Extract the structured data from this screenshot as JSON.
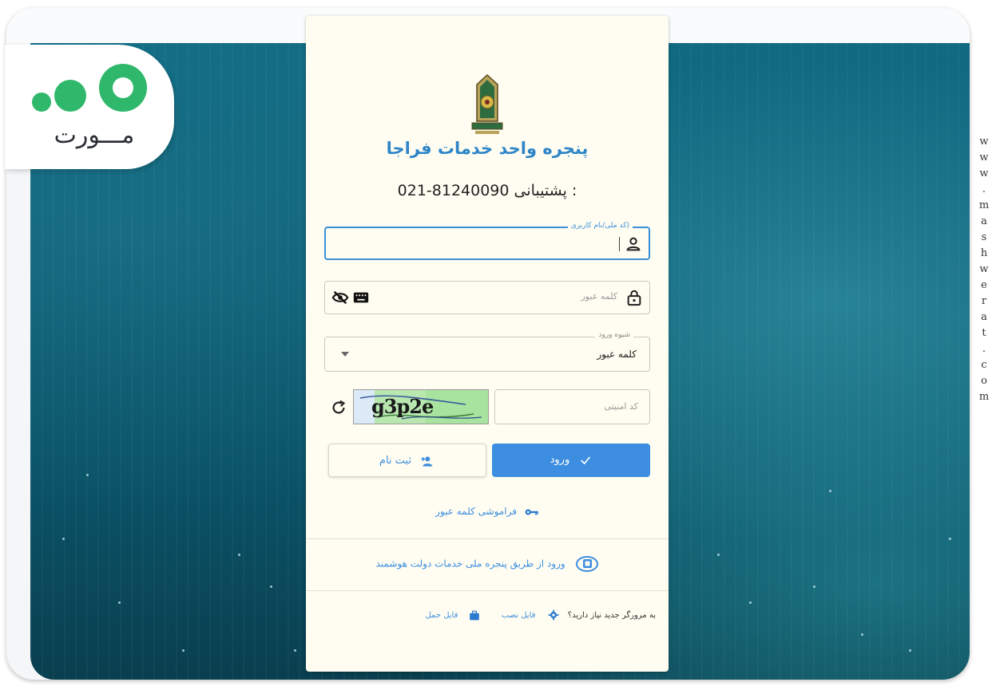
{
  "brand": {
    "logo_text": "مـــورت"
  },
  "watermark": {
    "text": "www.mashwerat.com"
  },
  "card": {
    "title": "پنجره واحد خدمات فراجا",
    "support_number": "021-81240090",
    "support_label": ": پشتیبانی"
  },
  "form": {
    "username_legend": "(کد ملی/نام کاربری",
    "password_placeholder": "کلمه عبور",
    "login_method_legend": "شیوه ورود",
    "login_method_value": "کلمه عبور",
    "captcha_placeholder": "کد امنیتی",
    "captcha_text": "g3p2e"
  },
  "buttons": {
    "login": "ورود",
    "register": "ثبت نام"
  },
  "links": {
    "forgot_password": "فراموشی کلمه عبور",
    "gov_login": "ورود از طریق پنجره ملی خدمات دولت هوشمند",
    "browser_question": "به مرورگر جدید نیاز دارید؟",
    "install_file": "فایل نصب",
    "portable_file": "فایل حمل"
  },
  "colors": {
    "accent": "#3d8ee0",
    "card_bg": "#fffdf1",
    "background": "#0b5c72"
  }
}
